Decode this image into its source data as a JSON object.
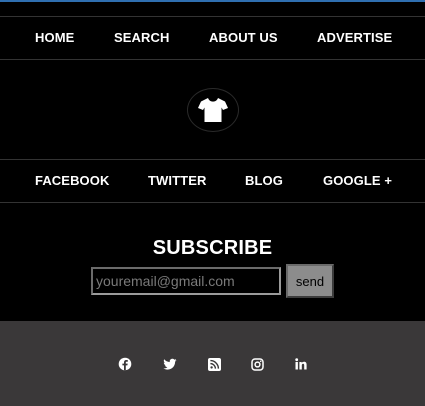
{
  "colors": {
    "background": "#000000",
    "footer": "#3a3839",
    "accent_top_line": "#2f6fb0",
    "text": "#ffffff",
    "send_button": "#8c8c8c"
  },
  "nav_primary": {
    "items": [
      {
        "label": "HOME"
      },
      {
        "label": "SEARCH"
      },
      {
        "label": "ABOUT US"
      },
      {
        "label": "ADVERTISE"
      }
    ]
  },
  "logo": {
    "icon": "tshirt-icon"
  },
  "nav_social": {
    "items": [
      {
        "label": "FACEBOOK"
      },
      {
        "label": "TWITTER"
      },
      {
        "label": "BLOG"
      },
      {
        "label": "GOOGLE +"
      }
    ]
  },
  "subscribe": {
    "title": "SUBSCRIBE",
    "email_placeholder": "youremail@gmail.com",
    "send_label": "send"
  },
  "footer": {
    "icons": [
      "facebook-icon",
      "twitter-icon",
      "rss-icon",
      "instagram-icon",
      "linkedin-icon"
    ]
  }
}
